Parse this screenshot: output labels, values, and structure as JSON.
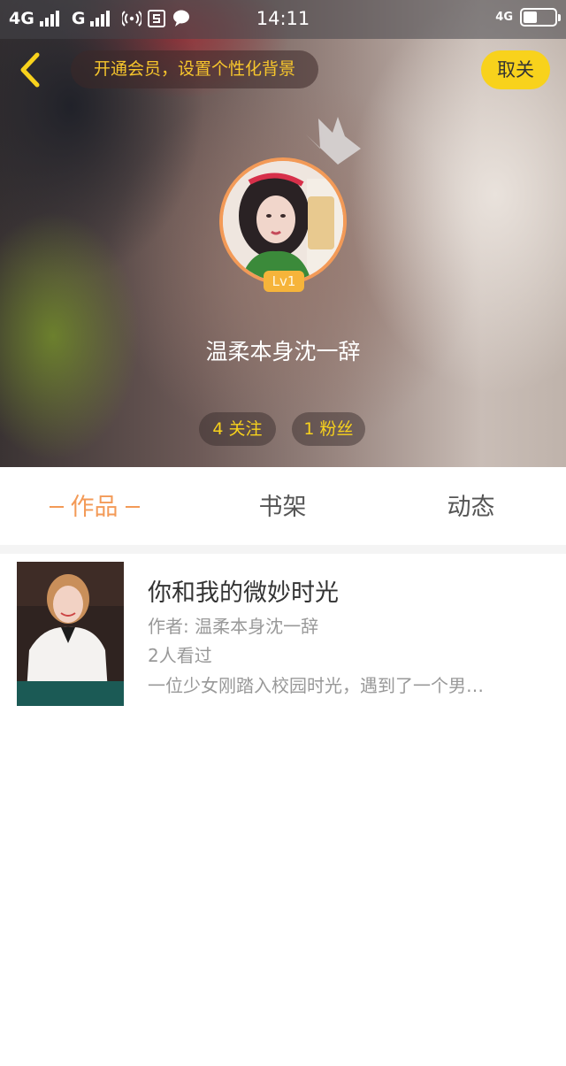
{
  "status_bar": {
    "network1": "4G",
    "network2": "G",
    "time": "14:11",
    "network_right": "4G",
    "battery_level": 0.45
  },
  "header": {
    "vip_prompt": "开通会员，设置个性化背景",
    "unfollow_label": "取关",
    "accent_color": "#f8d21c"
  },
  "profile": {
    "level": "Lv1",
    "username": "温柔本身沈一辞",
    "following": "4 关注",
    "fans": "1 粉丝"
  },
  "tabs": [
    {
      "label": "作品",
      "active": true
    },
    {
      "label": "书架",
      "active": false
    },
    {
      "label": "动态",
      "active": false
    }
  ],
  "works": [
    {
      "title": "你和我的微妙时光",
      "author": "作者: 温柔本身沈一辞",
      "views": "2人看过",
      "description": "一位少女刚踏入校园时光，遇到了一个男…"
    }
  ],
  "colors": {
    "tab_active": "#f39a57",
    "avatar_ring": "#f39a57",
    "level_badge": "#f6b43a"
  }
}
